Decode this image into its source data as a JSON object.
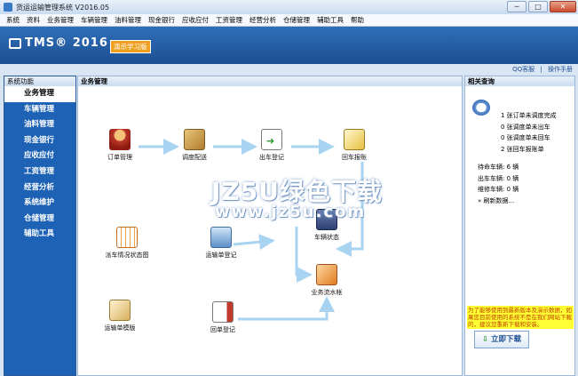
{
  "window": {
    "title": "货运运输管理系统 V2016.05",
    "minimize": "─",
    "maximize": "□",
    "close": "✕"
  },
  "menu": [
    "系统",
    "资料",
    "业务管理",
    "车辆管理",
    "油料管理",
    "现金银行",
    "应收应付",
    "工资管理",
    "经营分析",
    "仓储管理",
    "辅助工具",
    "帮助"
  ],
  "banner": {
    "logo": "TMS® 2016",
    "badge": "演示学习版"
  },
  "toplinks": [
    "QQ客服",
    "操作手册"
  ],
  "sidebar": {
    "header": "系统功能",
    "items": [
      "业务管理",
      "车辆管理",
      "油料管理",
      "现金银行",
      "应收应付",
      "工资管理",
      "经营分析",
      "系统维护",
      "仓储管理",
      "辅助工具"
    ]
  },
  "main": {
    "header": "业务管理",
    "nodes": {
      "order": "订单管理",
      "dispatch": "调度配送",
      "depart": "出车登记",
      "return": "回车报账",
      "vehicle_status": "车辆状态",
      "waybill_register": "运输单登记",
      "vehicle_chart": "派车情况状态图",
      "ledger": "业务流水帐",
      "waybill_template": "运输单模版",
      "receipt": "回单登记"
    }
  },
  "right": {
    "header": "相关查询",
    "stats": [
      "1 张订单未调度完成",
      "0 张调度单未出车",
      "0 张调度单未回车",
      "2 张回车报账单"
    ],
    "stats2": [
      "待命车辆: 6 辆",
      "出车车辆: 0 辆",
      "维修车辆: 0 辆",
      "» 刷新数据..."
    ],
    "notice": "为了能够使用到最新版本及演示数据，如果您目前使用的系统不是在我们网站下载的，建议您重新下载和安装。",
    "download": "立即下载"
  },
  "watermark": {
    "text": "JZ5U绿色下载",
    "url": "www.jz5u.com"
  },
  "colors": {
    "accent": "#1e62b5",
    "arrow": "#a8d4f2",
    "notice": "#ffff33"
  }
}
